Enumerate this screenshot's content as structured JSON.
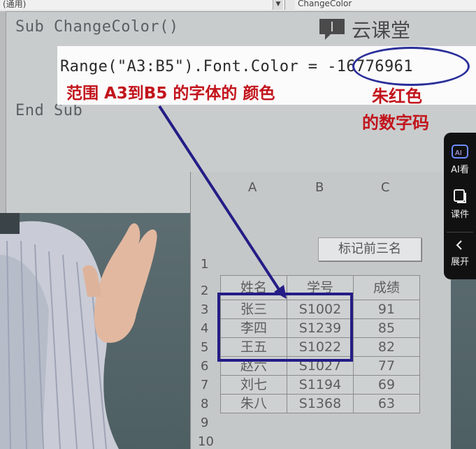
{
  "editor": {
    "dropdown_left": "(通用)",
    "dropdown_right": "ChangeColor",
    "line_sub": "Sub ChangeColor()",
    "line_end": "End Sub"
  },
  "watermark": {
    "logo_text": "云课堂"
  },
  "callout": {
    "code": "Range(\"A3:B5\").Font.Color = ",
    "value": "-16776961",
    "note": "范围 A3到B5 的字体的 颜色",
    "color_note_line1": "朱红色",
    "color_note_line2": "的数字码"
  },
  "sheet": {
    "columns": [
      "A",
      "B",
      "C"
    ],
    "row_numbers": [
      "1",
      "2",
      "3",
      "4",
      "5",
      "6",
      "7",
      "8",
      "9",
      "10"
    ],
    "button_label": "标记前三名",
    "headers": [
      "姓名",
      "学号",
      "成绩"
    ],
    "rows": [
      [
        "张三",
        "S1002",
        "91"
      ],
      [
        "李四",
        "S1239",
        "85"
      ],
      [
        "王五",
        "S1022",
        "82"
      ],
      [
        "赵六",
        "S1027",
        "77"
      ],
      [
        "刘七",
        "S1194",
        "69"
      ],
      [
        "朱八",
        "S1368",
        "63"
      ]
    ]
  },
  "sidebar": {
    "items": [
      {
        "label": "AI看",
        "icon": "ai-video-icon"
      },
      {
        "label": "课件",
        "icon": "courseware-icon"
      },
      {
        "label": "展开",
        "icon": "chevron-left-icon"
      }
    ]
  },
  "colors": {
    "annotation_red": "#c2141c",
    "annotation_blue": "#241d86",
    "sidebar_bg": "#111111"
  }
}
